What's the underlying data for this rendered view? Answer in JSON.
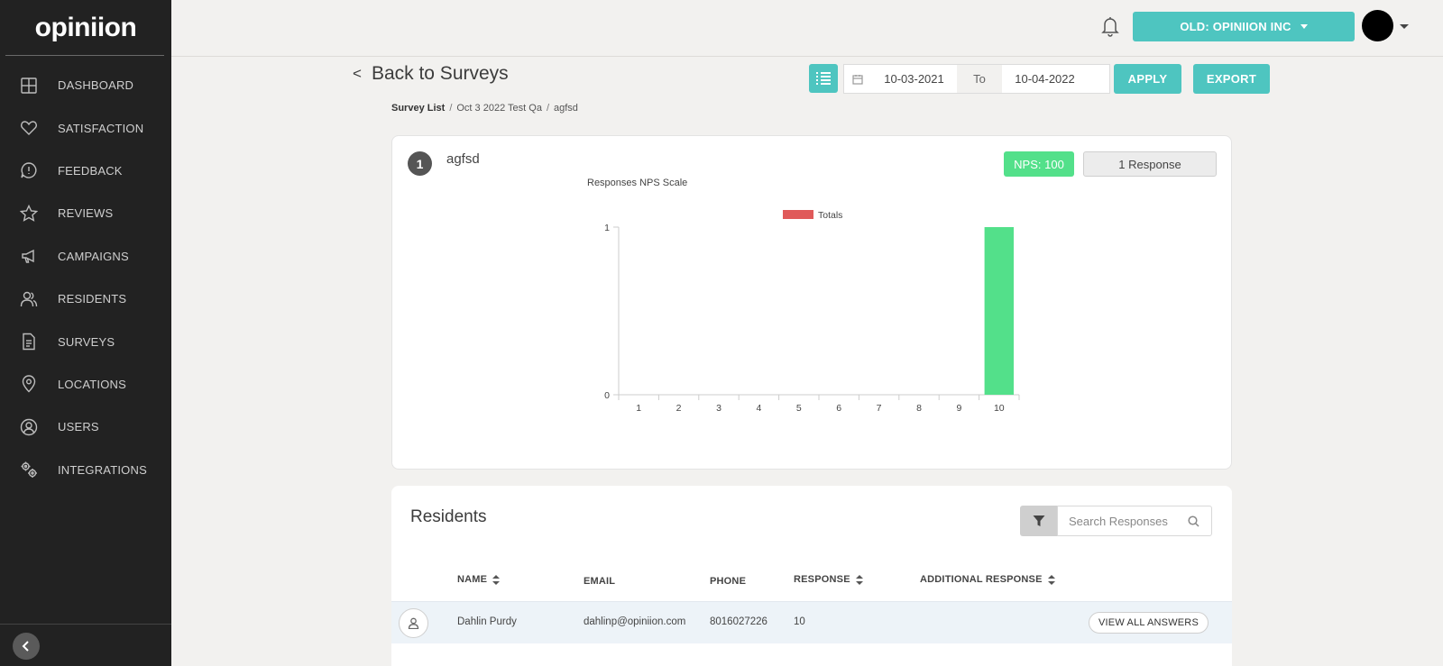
{
  "app": {
    "logo_text": "opiniion"
  },
  "sidebar": {
    "items": [
      {
        "label": "DASHBOARD",
        "icon": "grid-icon"
      },
      {
        "label": "SATISFACTION",
        "icon": "heart-icon"
      },
      {
        "label": "FEEDBACK",
        "icon": "chat-alert-icon"
      },
      {
        "label": "REVIEWS",
        "icon": "star-icon"
      },
      {
        "label": "CAMPAIGNS",
        "icon": "megaphone-icon"
      },
      {
        "label": "RESIDENTS",
        "icon": "users-icon"
      },
      {
        "label": "SURVEYS",
        "icon": "document-icon"
      },
      {
        "label": "LOCATIONS",
        "icon": "map-pin-icon"
      },
      {
        "label": "USERS",
        "icon": "user-circle-icon"
      },
      {
        "label": "INTEGRATIONS",
        "icon": "gears-icon"
      }
    ]
  },
  "header": {
    "org_label": "OLD: OPINIION INC"
  },
  "toolbar": {
    "back_label": "Back to Surveys",
    "date_from": "10-03-2021",
    "date_to_label": "To",
    "date_to": "10-04-2022",
    "apply_label": "APPLY",
    "export_label": "EXPORT"
  },
  "breadcrumb": {
    "root": "Survey List",
    "survey": "Oct 3 2022 Test Qa",
    "question": "agfsd"
  },
  "question": {
    "number": "1",
    "title": "agfsd",
    "nps_label": "NPS: 100",
    "responses_label": "1 Response"
  },
  "chart_data": {
    "type": "bar",
    "title": "Responses NPS Scale",
    "legend": [
      "Totals"
    ],
    "legend_color": "#e05a5a",
    "bar_color": "#53e08a",
    "categories": [
      "1",
      "2",
      "3",
      "4",
      "5",
      "6",
      "7",
      "8",
      "9",
      "10"
    ],
    "series": [
      {
        "name": "Totals",
        "values": [
          0,
          0,
          0,
          0,
          0,
          0,
          0,
          0,
          0,
          1
        ]
      }
    ],
    "ylim": [
      0,
      1
    ],
    "yticks": [
      "0",
      "1"
    ],
    "grid": false,
    "legend_position": "top"
  },
  "residents": {
    "title": "Residents",
    "search_placeholder": "Search Responses",
    "columns": {
      "name": "NAME",
      "email": "EMAIL",
      "phone": "PHONE",
      "response": "RESPONSE",
      "additional": "ADDITIONAL RESPONSE"
    },
    "rows": [
      {
        "name": "Dahlin Purdy",
        "email": "dahlinp@opiniion.com",
        "phone": "8016027226",
        "response": "10",
        "action": "VIEW ALL ANSWERS"
      }
    ]
  }
}
